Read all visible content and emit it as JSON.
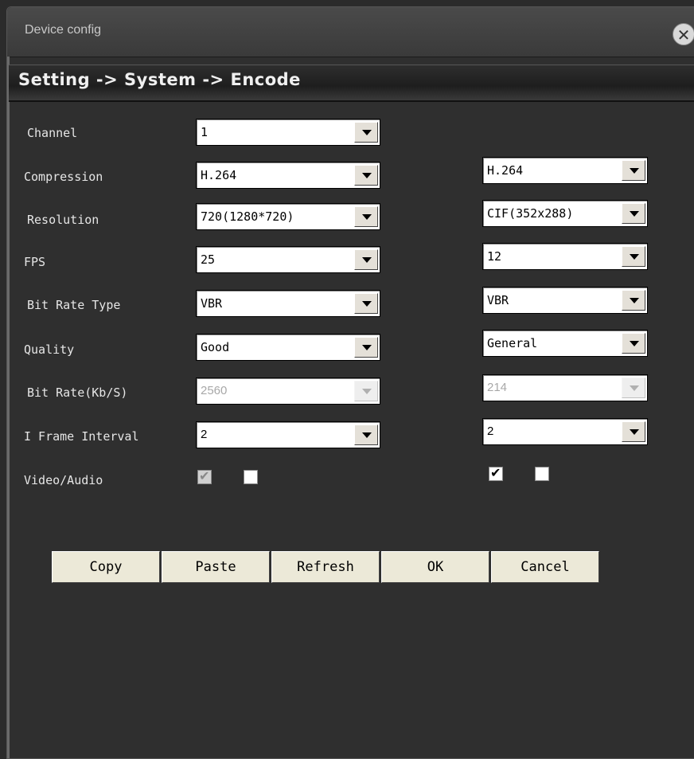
{
  "window": {
    "title": "Device config",
    "close_icon": "close-circle-icon"
  },
  "breadcrumb": "Setting -> System -> Encode",
  "rows": {
    "channel": {
      "label": "Channel",
      "main": "1"
    },
    "compression": {
      "label": "Compression",
      "main": "H.264",
      "extra": "H.264"
    },
    "resolution": {
      "label": "Resolution",
      "main": "720(1280*720)",
      "extra": "CIF(352x288)"
    },
    "fps": {
      "label": "FPS",
      "main": "25",
      "extra": "12"
    },
    "bitrate_type": {
      "label": "Bit Rate Type",
      "main": "VBR",
      "extra": "VBR"
    },
    "quality": {
      "label": "Quality",
      "main": "Good",
      "extra": "General"
    },
    "bitrate": {
      "label": "Bit Rate(Kb/S)",
      "main": "2560",
      "extra": "214"
    },
    "iframe": {
      "label": "I Frame Interval",
      "main": "2",
      "extra": "2"
    },
    "video_audio": {
      "label": "Video/Audio",
      "main_video": true,
      "main_audio": false,
      "extra_video": true,
      "extra_audio": false
    }
  },
  "buttons": {
    "copy": "Copy",
    "paste": "Paste",
    "refresh": "Refresh",
    "ok": "OK",
    "cancel": "Cancel"
  }
}
